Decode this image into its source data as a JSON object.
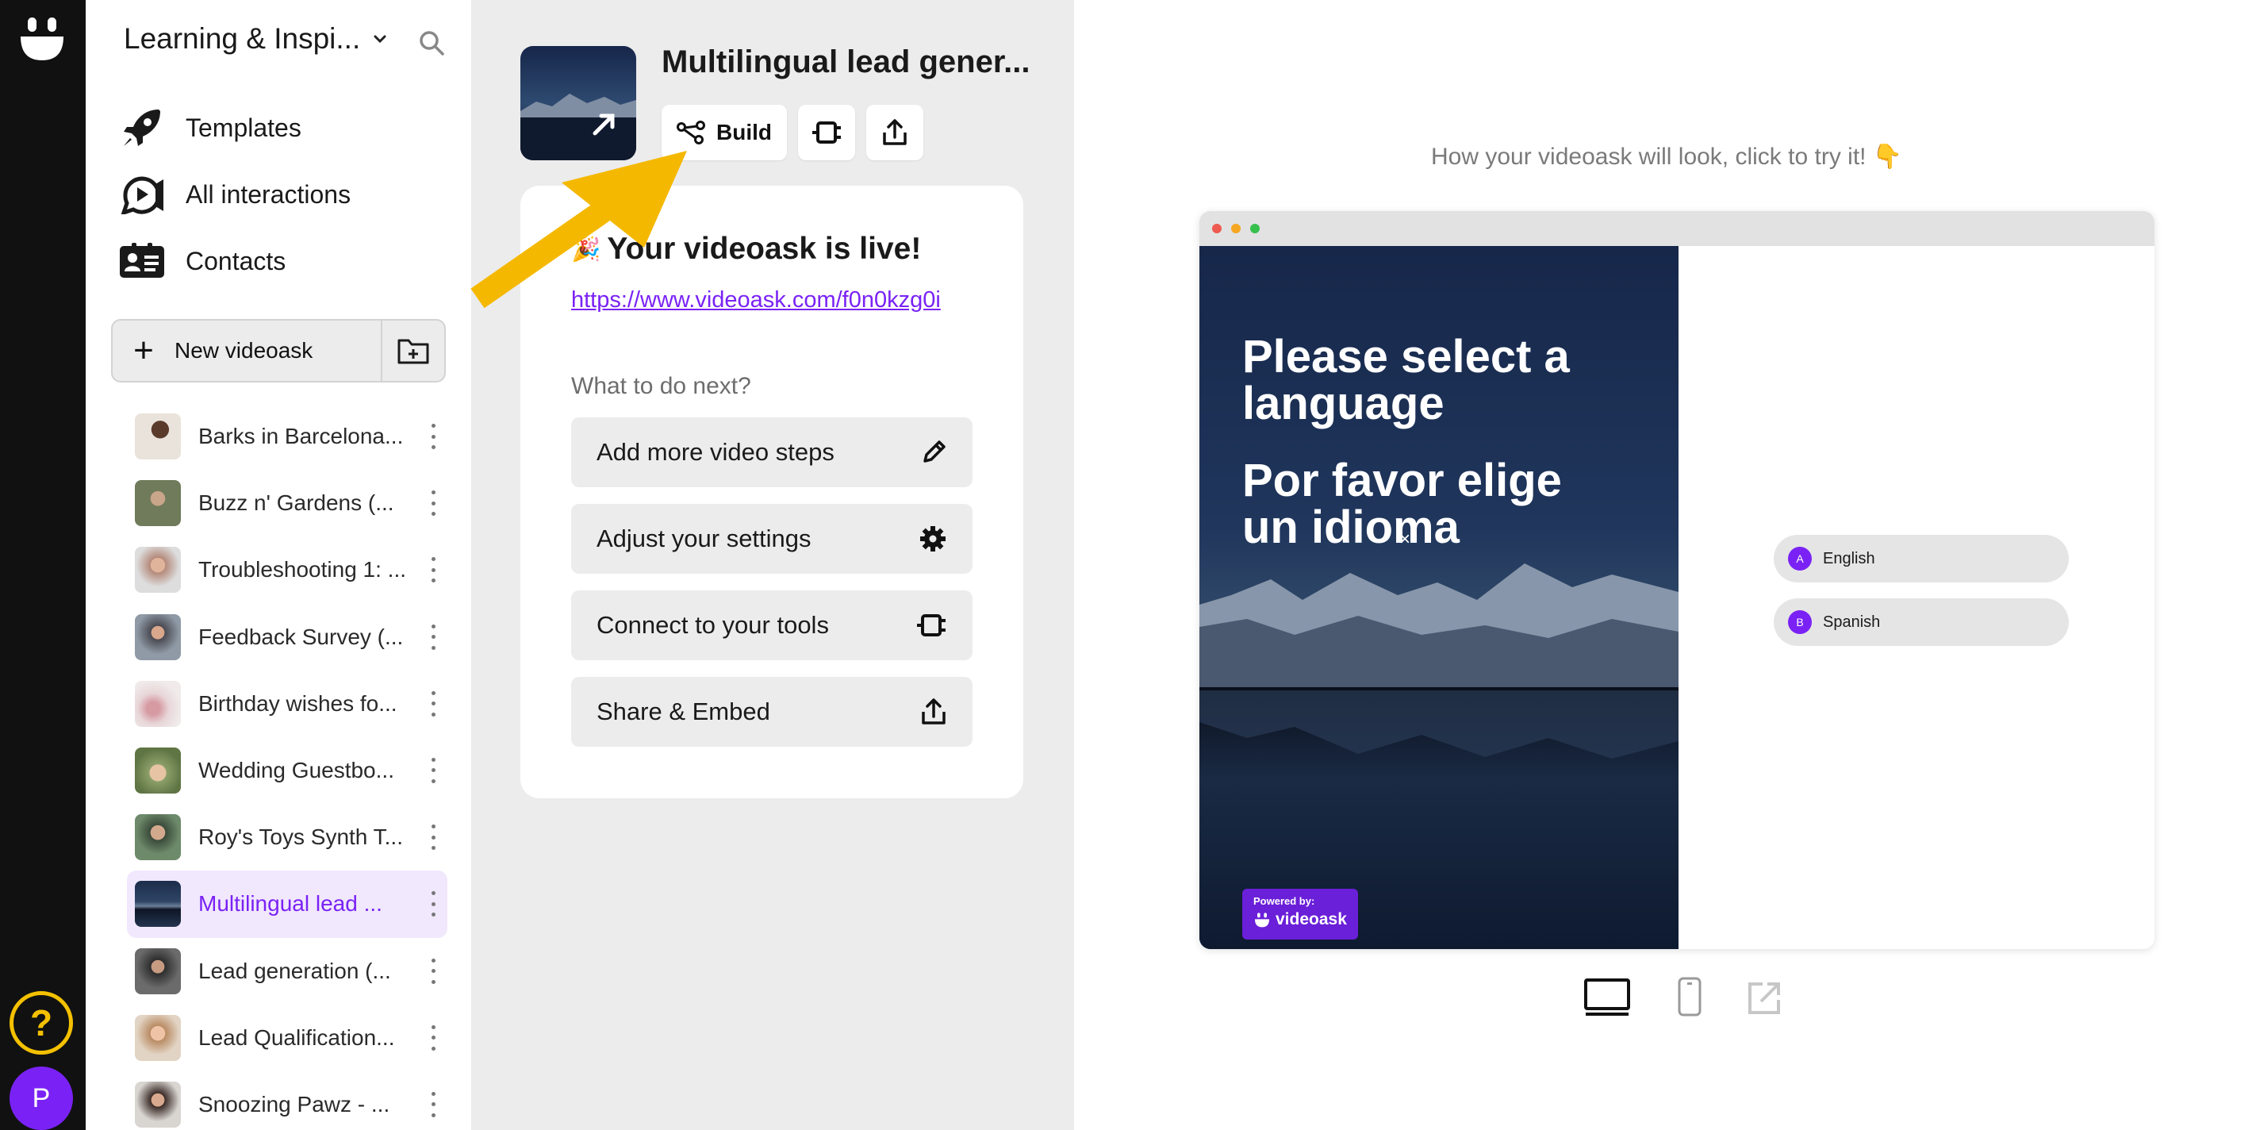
{
  "workspace": {
    "name": "Learning & Inspi..."
  },
  "nav": [
    {
      "label": "Templates"
    },
    {
      "label": "All interactions"
    },
    {
      "label": "Contacts"
    }
  ],
  "new_videoask": {
    "label": "New videoask"
  },
  "videoasks": [
    {
      "label": "Barks in Barcelona...",
      "active": false
    },
    {
      "label": "Buzz n' Gardens (...",
      "active": false
    },
    {
      "label": "Troubleshooting 1: ...",
      "active": false
    },
    {
      "label": "Feedback Survey (...",
      "active": false
    },
    {
      "label": "Birthday wishes fo...",
      "active": false
    },
    {
      "label": "Wedding Guestbo...",
      "active": false
    },
    {
      "label": "Roy's Toys Synth T...",
      "active": false
    },
    {
      "label": "Multilingual lead ...",
      "active": true
    },
    {
      "label": "Lead generation (...",
      "active": false
    },
    {
      "label": "Lead Qualification...",
      "active": false
    },
    {
      "label": "Snoozing Pawz - ...",
      "active": false
    }
  ],
  "detail": {
    "title": "Multilingual lead gener...",
    "build_label": "Build",
    "live_emoji": "🎉",
    "live_text": "Your videoask is live!",
    "url": "https://www.videoask.com/f0n0kzg0i",
    "next_label": "What to do next?",
    "actions": [
      {
        "label": "Add more video steps",
        "icon": "pencil-icon"
      },
      {
        "label": "Adjust your settings",
        "icon": "gear-icon"
      },
      {
        "label": "Connect to your tools",
        "icon": "plug-icon"
      },
      {
        "label": "Share & Embed",
        "icon": "share-icon"
      }
    ]
  },
  "preview": {
    "hint": "How your videoask will look, click to try it! 👇",
    "question_en": "Please select a language",
    "question_es": "Por favor elige un idioma",
    "close_glyph": "×",
    "powered_by": "Powered by:",
    "brand": "videoask",
    "options": [
      {
        "letter": "A",
        "label": "English"
      },
      {
        "letter": "B",
        "label": "Spanish"
      }
    ]
  },
  "user": {
    "initial": "P"
  },
  "help": {
    "glyph": "?"
  },
  "colors": {
    "accent": "#7a22f5",
    "arrow": "#f5b800",
    "rail": "#111111",
    "panel": "#ececec"
  }
}
